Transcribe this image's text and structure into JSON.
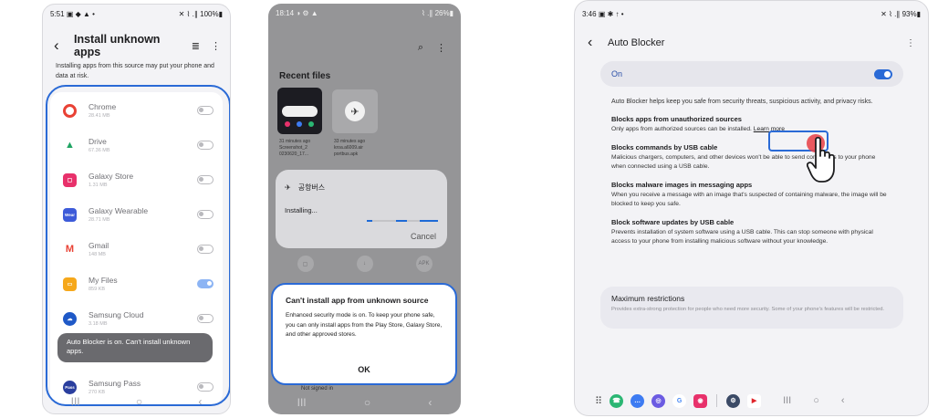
{
  "phone1": {
    "status": {
      "time": "5:51",
      "icons": "▣ ◆ ▲ •",
      "battery": "✕ ⌇ .∥ 100%▮"
    },
    "title": "Install unknown apps",
    "back_icon": "‹",
    "search_icon": "≣",
    "more_icon": "⋮",
    "description": "Installing apps from this source may put your phone and data at risk.",
    "apps": [
      {
        "name": "Chrome",
        "size": "28.41 MB",
        "color": "#e94235",
        "glyph": "◉",
        "on": false
      },
      {
        "name": "Drive",
        "size": "67.36 MB",
        "color": "#1fa463",
        "glyph": "▲",
        "on": false
      },
      {
        "name": "Galaxy Store",
        "size": "1.31 MB",
        "color": "#e8316b",
        "glyph": "▢",
        "on": false
      },
      {
        "name": "Galaxy Wearable",
        "size": "28.71 MB",
        "color": "#3d5bd9",
        "glyph": "Wear",
        "on": false
      },
      {
        "name": "Gmail",
        "size": "148 MB",
        "color": "#ffffff",
        "glyph": "M",
        "on": false
      },
      {
        "name": "My Files",
        "size": "859 KB",
        "color": "#f6a81b",
        "glyph": "▭",
        "on": true
      },
      {
        "name": "Samsung Cloud",
        "size": "3.18 MB",
        "color": "#1f59c7",
        "glyph": "☁",
        "on": false
      },
      {
        "name": "Samsung Pass",
        "size": "270 KB",
        "color": "#2a3e9e",
        "glyph": "Pass",
        "on": false
      }
    ],
    "toast": "Auto Blocker is on. Can't install unknown apps.",
    "nav": [
      "III",
      "○",
      "‹"
    ]
  },
  "phone2": {
    "status": {
      "time": "18:14",
      "icons": "◑ ⚙ ▲",
      "battery": "⌇ .∥ 26%▮"
    },
    "search_icon": "⌕",
    "more_icon": "⋮",
    "recent_title": "Recent files",
    "files": [
      {
        "time": "31 minutes ago",
        "name": "Screenshot_2 0230620_17..."
      },
      {
        "time": "33 minutes ago",
        "name": "kroa.a6009.air portbus.apk"
      }
    ],
    "install_app_name": "공항버스",
    "installing_label": "Installing...",
    "cancel_label": "Cancel",
    "docs": [
      "Documents",
      "Downloads",
      "Installation files"
    ],
    "dialog": {
      "title": "Can't install app from unknown source",
      "body": "Enhanced security mode is on. To keep your phone safe, you can only install apps from the Play Store, Galaxy Store, and other approved stores.",
      "ok": "OK"
    },
    "not_signed": "Not signed in",
    "nav": [
      "III",
      "○",
      "‹"
    ]
  },
  "phone3": {
    "status": {
      "time": "3:46",
      "icons": "▣ ✱ ↑ •",
      "battery": "✕ ⌇ .∥ 93%▮"
    },
    "title": "Auto Blocker",
    "back_icon": "‹",
    "more_icon": "⋮",
    "on_label": "On",
    "intro": "Auto Blocker helps keep you safe from security threats, suspicious activity, and privacy risks.",
    "sections": [
      {
        "title": "Blocks apps from unauthorized sources",
        "desc": "Only apps from authorized sources can be installed."
      },
      {
        "title": "Blocks commands by USB cable",
        "desc": "Malicious chargers, computers, and other devices won't be able to send commands to your phone when connected using a USB cable."
      },
      {
        "title": "Blocks malware images in messaging apps",
        "desc": "When you receive a message with an image that's suspected of containing malware, the image will be blocked to keep you safe."
      },
      {
        "title": "Block software updates by USB cable",
        "desc": "Prevents installation of system software using a USB cable. This can stop someone with physical access to your phone from installing malicious software without your knowledge."
      }
    ],
    "learn_more": "Learn more",
    "max_title": "Maximum restrictions",
    "max_desc": "Provides extra-strong protection for people who need more security. Some of your phone's features will be restricted.",
    "dock": [
      {
        "name": "phone",
        "color": "#2bb673",
        "glyph": "☎"
      },
      {
        "name": "messages",
        "color": "#3d7bf2",
        "glyph": "…"
      },
      {
        "name": "internet",
        "color": "#6b5be2",
        "glyph": "◎"
      },
      {
        "name": "google",
        "color": "#ffffff",
        "glyph": "G"
      },
      {
        "name": "camera",
        "color": "#e8316b",
        "glyph": "◉"
      },
      {
        "name": "settings",
        "color": "#3b4a66",
        "glyph": "⚙"
      },
      {
        "name": "youtube",
        "color": "#ffffff",
        "glyph": "▶"
      }
    ],
    "nav": [
      "III",
      "○",
      "‹"
    ]
  }
}
